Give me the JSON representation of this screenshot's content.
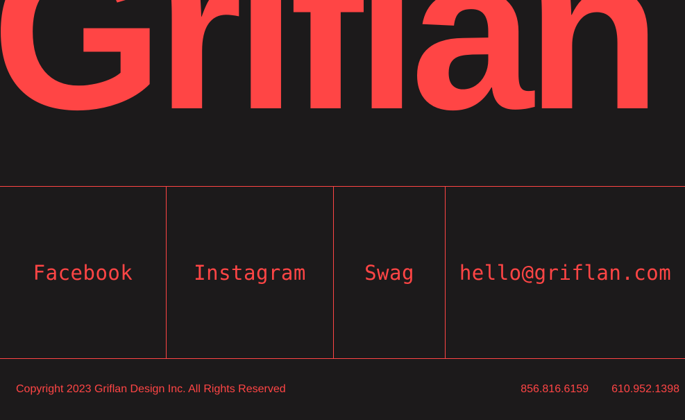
{
  "brand": {
    "wordmark": "Griflan"
  },
  "links": [
    {
      "label": "Facebook"
    },
    {
      "label": "Instagram"
    },
    {
      "label": "Swag"
    },
    {
      "label": "hello@griflan.com"
    }
  ],
  "footer": {
    "copyright": "Copyright 2023 Griflan Design Inc. All Rights Reserved",
    "phone_1": "856.816.6159",
    "phone_2": "610.952.1398"
  },
  "colors": {
    "background": "#1c1a1b",
    "accent": "#ff4545"
  }
}
